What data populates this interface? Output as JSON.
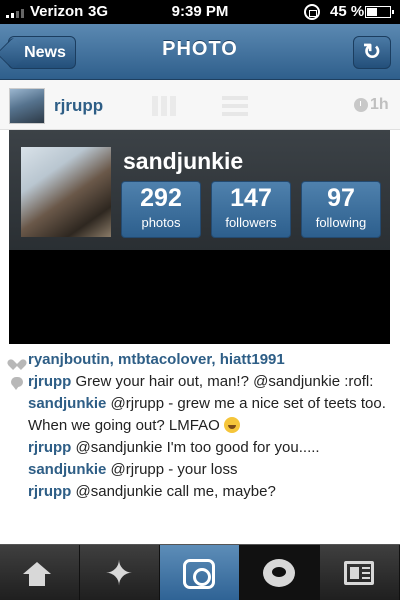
{
  "status_bar": {
    "carrier": "Verizon",
    "network": "3G",
    "time": "9:39 PM",
    "battery": "45 %"
  },
  "nav": {
    "back_label": "News",
    "title": "PHOTO",
    "refresh_icon": "refresh-icon"
  },
  "post": {
    "username": "rjrupp",
    "time_ago": "1h"
  },
  "profile_card": {
    "name": "sandjunkie",
    "stats": [
      {
        "value": "292",
        "label": "photos"
      },
      {
        "value": "147",
        "label": "followers"
      },
      {
        "value": "97",
        "label": "following"
      }
    ]
  },
  "likes": "ryanjboutin, mtbtacolover, hiatt1991",
  "comments": [
    {
      "user": "rjrupp",
      "text": " Grew your hair out, man!? @sandjunkie :rofl:"
    },
    {
      "user": "sandjunkie",
      "text": " @rjrupp - grew me a nice set of teets too.  When we going out? LMFAO"
    },
    {
      "user": "rjrupp",
      "text": " @sandjunkie I'm too good for you....."
    },
    {
      "user": "sandjunkie",
      "text": " @rjrupp - your loss"
    },
    {
      "user": "rjrupp",
      "text": " @sandjunkie call me, maybe?"
    }
  ],
  "tabs": [
    "home-icon",
    "explore-icon",
    "camera-icon",
    "news-icon",
    "profile-icon"
  ],
  "colors": {
    "nav_blue": "#2f5f8c",
    "link_blue": "#2e5e86",
    "tab_active": "#2f6395"
  }
}
